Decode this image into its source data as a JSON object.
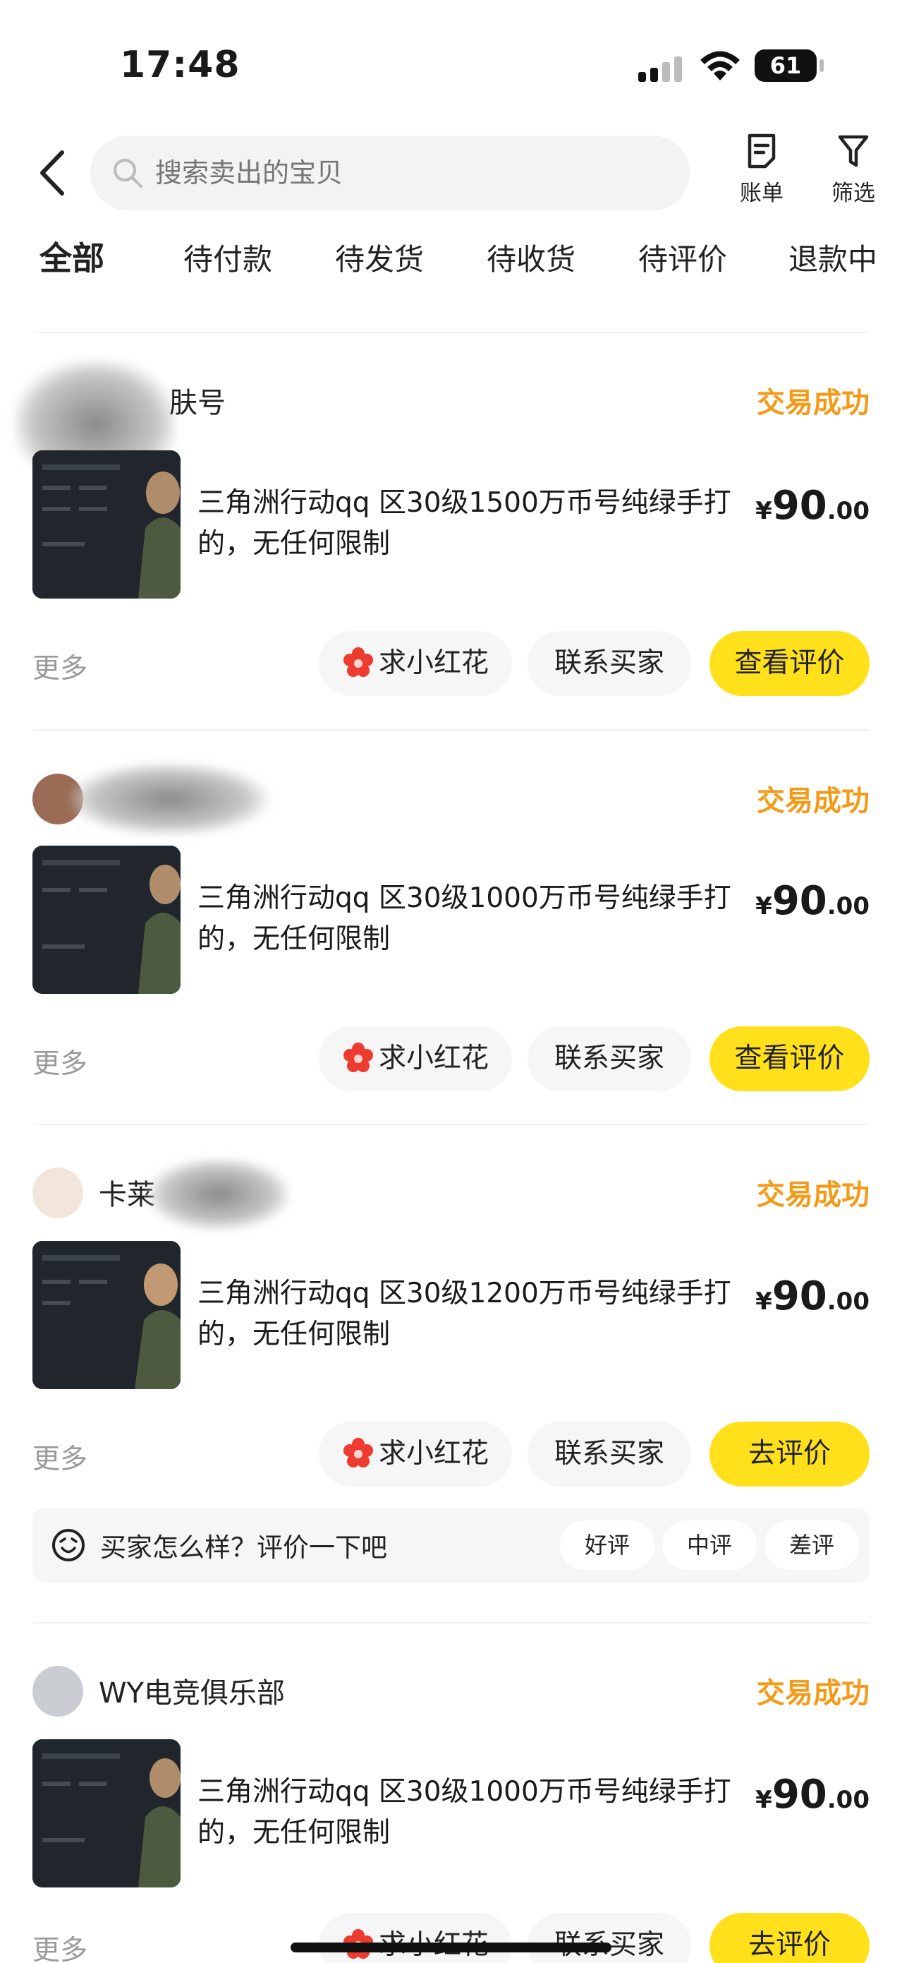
{
  "status_bar": {
    "time": "17:48",
    "battery": "61"
  },
  "header": {
    "search_placeholder": "搜索卖出的宝贝",
    "bill_label": "账单",
    "filter_label": "筛选"
  },
  "tabs": [
    "全部",
    "待付款",
    "待发货",
    "待收货",
    "待评价",
    "退款中"
  ],
  "orders": [
    {
      "seller": "肤号",
      "status": "交易成功",
      "title": "三角洲行动qq 区30级1500万币号纯绿手打的，无任何限制",
      "price": {
        "currency": "¥",
        "int": "90",
        "dec": ".00"
      },
      "more": "更多",
      "buttons": {
        "flower": "求小红花",
        "contact": "联系买家",
        "primary": "查看评价"
      }
    },
    {
      "seller": "",
      "status": "交易成功",
      "title": "三角洲行动qq 区30级1000万币号纯绿手打的，无任何限制",
      "price": {
        "currency": "¥",
        "int": "90",
        "dec": ".00"
      },
      "more": "更多",
      "buttons": {
        "flower": "求小红花",
        "contact": "联系买家",
        "primary": "查看评价"
      }
    },
    {
      "seller": "卡莱",
      "status": "交易成功",
      "title": "三角洲行动qq 区30级1200万币号纯绿手打的，无任何限制",
      "price": {
        "currency": "¥",
        "int": "90",
        "dec": ".00"
      },
      "more": "更多",
      "buttons": {
        "flower": "求小红花",
        "contact": "联系买家",
        "primary": "去评价"
      },
      "rating_prompt": {
        "question": "买家怎么样？评价一下吧",
        "good": "好评",
        "neutral": "中评",
        "bad": "差评"
      }
    },
    {
      "seller": "WY电竞俱乐部",
      "status": "交易成功",
      "title": "三角洲行动qq 区30级1000万币号纯绿手打的，无任何限制",
      "price": {
        "currency": "¥",
        "int": "90",
        "dec": ".00"
      },
      "more": "更多",
      "buttons": {
        "flower": "求小红花",
        "contact": "联系买家",
        "primary": "去评价"
      }
    }
  ],
  "colors": {
    "accent_yellow": "#ffe01b",
    "status_orange": "#f39a17",
    "flower_red": "#ee3b2f"
  }
}
